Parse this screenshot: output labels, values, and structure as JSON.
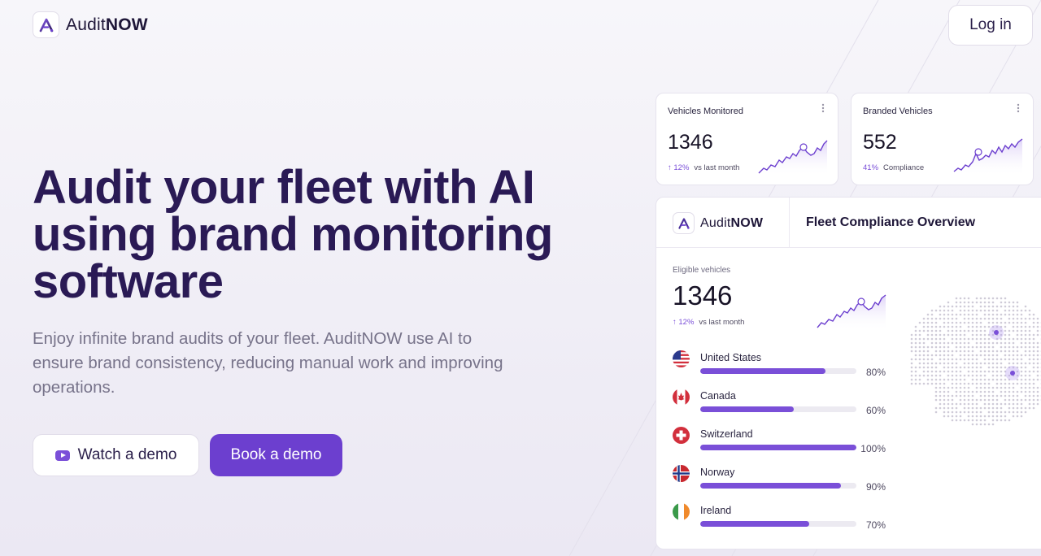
{
  "brand": {
    "name_regular": "Audit",
    "name_bold": "NOW",
    "logo_letter": "A"
  },
  "header": {
    "login_label": "Log in"
  },
  "hero": {
    "headline": "Audit your fleet with AI using brand monitoring software",
    "subtext": "Enjoy infinite brand audits of your fleet. AuditNOW use AI to ensure brand consistency, reducing manual work and improving operations.",
    "watch_demo_label": "Watch a demo",
    "book_demo_label": "Book a demo"
  },
  "stats": [
    {
      "title": "Vehicles Monitored",
      "value": "1346",
      "delta": "12%",
      "delta_label": "vs last month",
      "trend": "up"
    },
    {
      "title": "Branded Vehicles",
      "value": "552",
      "delta": "41%",
      "delta_label": "Compliance",
      "trend": "none"
    }
  ],
  "panel": {
    "title": "Fleet Compliance Overview",
    "eligible_label": "Eligible vehicles",
    "eligible_value": "1346",
    "eligible_delta": "12%",
    "eligible_delta_label": "vs last month"
  },
  "countries": [
    {
      "name": "United States",
      "percent_label": "80%",
      "percent": 80,
      "flag": "us-flag-icon"
    },
    {
      "name": "Canada",
      "percent_label": "60%",
      "percent": 60,
      "flag": "canada-flag-icon"
    },
    {
      "name": "Switzerland",
      "percent_label": "100%",
      "percent": 100,
      "flag": "switzerland-flag-icon"
    },
    {
      "name": "Norway",
      "percent_label": "90%",
      "percent": 90,
      "flag": "norway-flag-icon"
    },
    {
      "name": "Ireland",
      "percent_label": "70%",
      "percent": 70,
      "flag": "ireland-flag-icon"
    }
  ],
  "colors": {
    "accent": "#6c3fcf",
    "headline": "#2a1a55",
    "bar": "#7a4fd8",
    "track": "#eceaf1"
  }
}
